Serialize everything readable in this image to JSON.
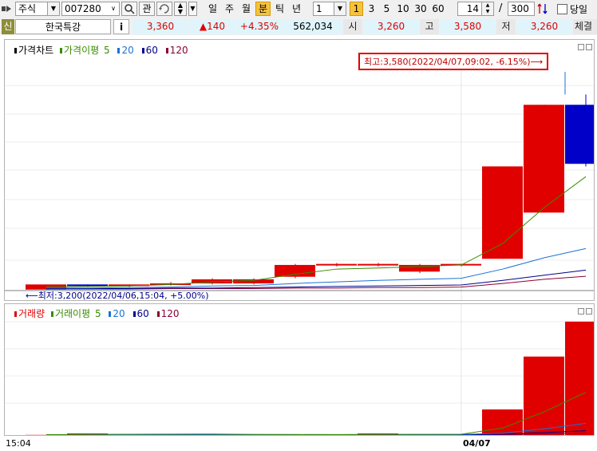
{
  "toolbar": {
    "market_select": "주식",
    "stock_code": "007280",
    "btn_interest": "관",
    "period_buttons": [
      "일",
      "주",
      "월",
      "분",
      "틱",
      "년"
    ],
    "period_selected": "분",
    "interval_value": "1",
    "interval_buttons": [
      "1",
      "3",
      "5",
      "10",
      "30",
      "60"
    ],
    "interval_selected": "1",
    "view_count": "14",
    "separator": "/",
    "total_count": "300",
    "today_label": "당일"
  },
  "info": {
    "credit_badge": "신",
    "stock_name": "한국특강",
    "info_button": "i",
    "price": "3,360",
    "change": "▲140",
    "change_pct": "+4.35%",
    "volume": "562,034",
    "open_label": "시",
    "open": "3,260",
    "high_label": "고",
    "high": "3,580",
    "low_label": "저",
    "low": "3,260",
    "strength_label": "체결강"
  },
  "colors": {
    "up": "#e00000",
    "down": "#0000c8",
    "ma5": "#3a8c00",
    "ma20": "#1a72d6",
    "ma60": "#00008b",
    "ma120": "#8b0033"
  },
  "price_panel": {
    "title": "가격차트",
    "ma_title": "가격이평",
    "ma_periods": [
      "5",
      "20",
      "60",
      "120"
    ],
    "high_annotation": "최고:3,580(2022/04/07,09:02, -6.15%)⟶",
    "low_annotation": "⟵최저:3,200(2022/04/06,15:04, +5.00%)"
  },
  "volume_panel": {
    "title": "거래량",
    "ma_title": "거래이평",
    "ma_periods": [
      "5",
      "20",
      "60",
      "120"
    ]
  },
  "xaxis": {
    "left_label": "15:04",
    "date_label": "04/07"
  },
  "chart_data": {
    "type": "candlestick",
    "candles": [
      {
        "o": 3200,
        "h": 3210,
        "l": 3200,
        "c": 3210
      },
      {
        "o": 3210,
        "h": 3210,
        "l": 3205,
        "c": 3208
      },
      {
        "o": 3208,
        "h": 3210,
        "l": 3205,
        "c": 3210
      },
      {
        "o": 3210,
        "h": 3215,
        "l": 3208,
        "c": 3212
      },
      {
        "o": 3212,
        "h": 3222,
        "l": 3210,
        "c": 3220
      },
      {
        "o": 3212,
        "h": 3222,
        "l": 3210,
        "c": 3220
      },
      {
        "o": 3225,
        "h": 3250,
        "l": 3222,
        "c": 3248
      },
      {
        "o": 3248,
        "h": 3252,
        "l": 3245,
        "c": 3250
      },
      {
        "o": 3248,
        "h": 3252,
        "l": 3245,
        "c": 3250
      },
      {
        "o": 3235,
        "h": 3250,
        "l": 3232,
        "c": 3248
      },
      {
        "o": 3248,
        "h": 3250,
        "l": 3245,
        "c": 3250
      },
      {
        "o": 3260,
        "h": 3440,
        "l": 3260,
        "c": 3440
      },
      {
        "o": 3350,
        "h": 3560,
        "l": 3350,
        "c": 3560
      },
      {
        "o": 3560,
        "h": 3580,
        "l": 3440,
        "c": 3445
      }
    ],
    "ma_price": {
      "ma5": [
        3205,
        3206,
        3207,
        3210,
        3215,
        3218,
        3230,
        3240,
        3242,
        3245,
        3248,
        3290,
        3360,
        3420
      ],
      "ma20": [
        3203,
        3203,
        3204,
        3205,
        3207,
        3208,
        3212,
        3215,
        3218,
        3220,
        3222,
        3240,
        3262,
        3280
      ],
      "ma60": [
        3202,
        3202,
        3202,
        3203,
        3203,
        3204,
        3205,
        3206,
        3207,
        3208,
        3209,
        3218,
        3228,
        3238
      ],
      "ma120": [
        3201,
        3201,
        3201,
        3202,
        3202,
        3202,
        3203,
        3203,
        3204,
        3204,
        3205,
        3212,
        3220,
        3226
      ]
    },
    "volumes": [
      200,
      2000,
      300,
      500,
      600,
      800,
      300,
      400,
      2000,
      600,
      700,
      33000,
      101000,
      146000
    ],
    "ma_volume": {
      "ma5": [
        500,
        800,
        1000,
        1200,
        1300,
        800,
        600,
        500,
        800,
        900,
        1000,
        9000,
        30000,
        55000
      ],
      "ma20": [
        300,
        400,
        500,
        600,
        650,
        650,
        600,
        600,
        650,
        700,
        750,
        2500,
        8000,
        15000
      ],
      "ma60": [
        200,
        250,
        300,
        320,
        340,
        350,
        360,
        370,
        380,
        400,
        420,
        1000,
        3200,
        5500
      ],
      "ma120": [
        150,
        170,
        180,
        190,
        200,
        210,
        215,
        220,
        225,
        230,
        240,
        500,
        1500,
        2300
      ]
    },
    "price_range": [
      3195,
      3590
    ],
    "volume_range": [
      0,
      150000
    ]
  }
}
